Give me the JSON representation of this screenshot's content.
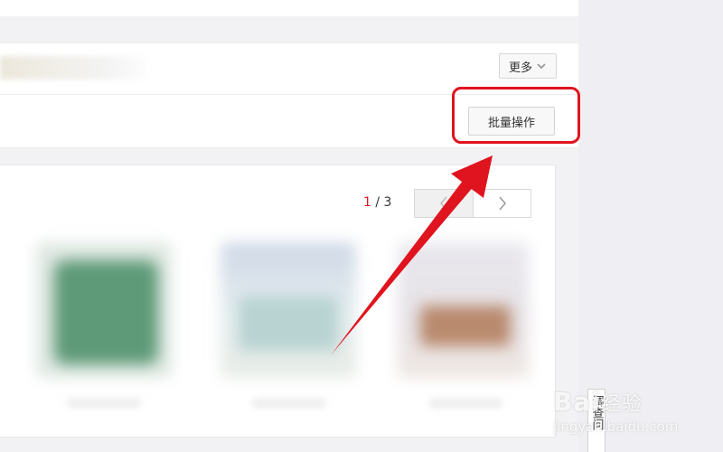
{
  "toolbar": {
    "more_label": "更多"
  },
  "actions": {
    "batch_label": "批量操作"
  },
  "pager": {
    "current": "1",
    "separator": " / ",
    "total": "3"
  },
  "side_tab": {
    "label": "调查问"
  },
  "watermark": {
    "logo": "Bai",
    "cn": "经验",
    "url": "jingyan.baidu.com"
  },
  "colors": {
    "accent_red": "#e0141e",
    "gutter": "#efeff3"
  },
  "icons": [
    "chevron-down-icon",
    "chevron-left-icon",
    "chevron-right-icon",
    "annotation-arrow"
  ]
}
